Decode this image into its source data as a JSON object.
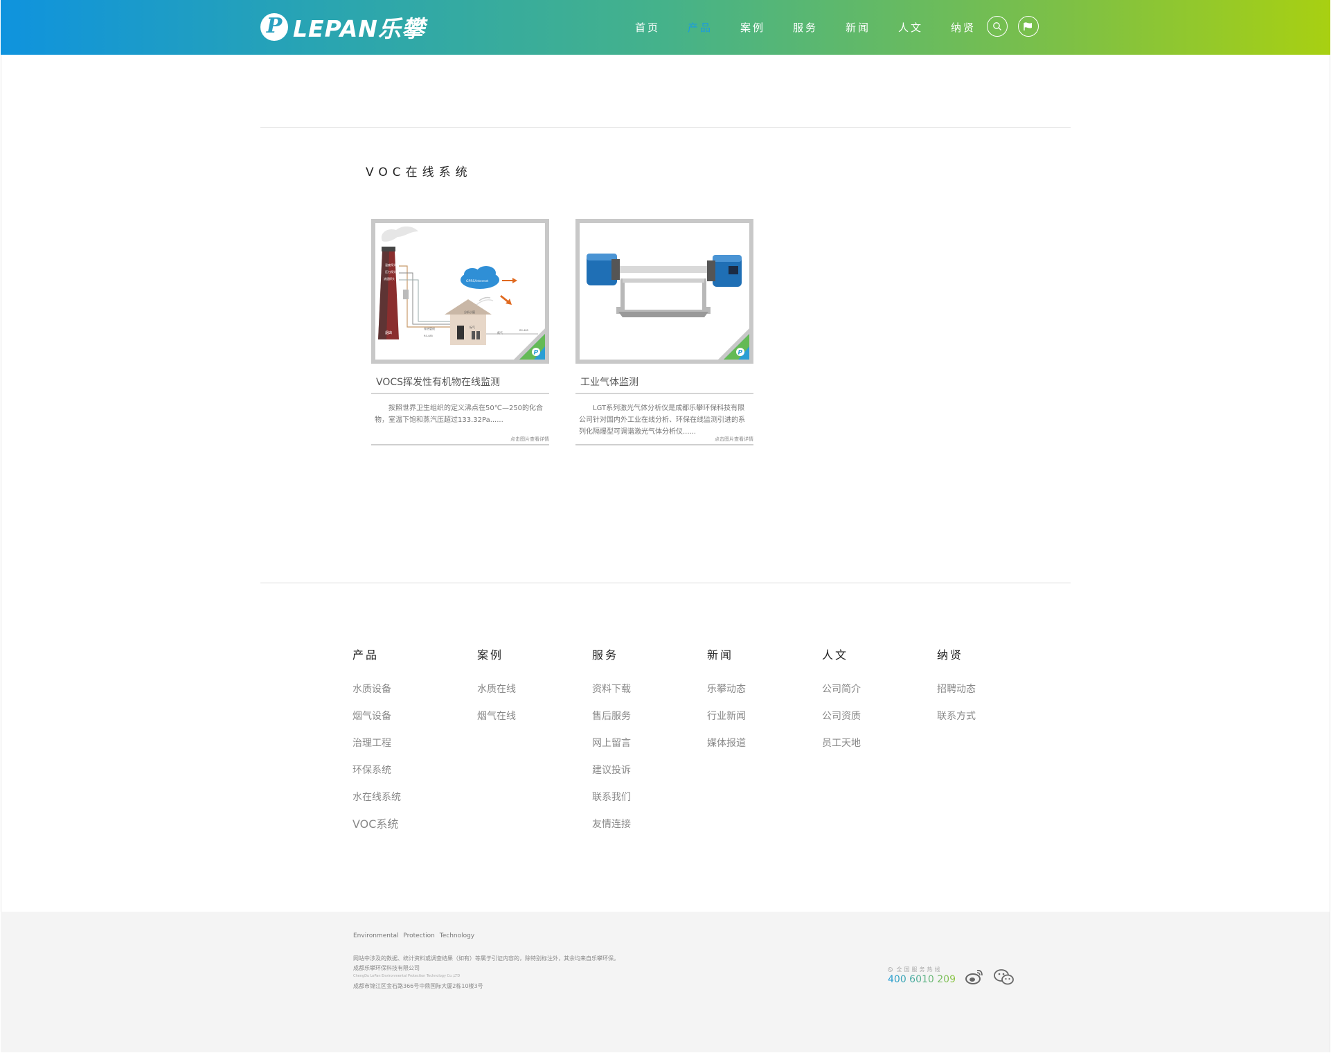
{
  "header": {
    "logo_glyph": "P",
    "logo_text": "LEPAN乐攀",
    "nav": [
      "首页",
      "产品",
      "案例",
      "服务",
      "新闻",
      "人文",
      "纳贤"
    ],
    "active_index": 1,
    "gradient": [
      "#0f93de",
      "#a8d012"
    ]
  },
  "category": {
    "title": "VOC在线系统"
  },
  "products": [
    {
      "title": "VOCS挥发性有机物在线监测",
      "desc": "按照世界卫生组织的定义沸点在50℃—250的化合物，室温下饱和蒸汽压超过133.32Pa......",
      "more": "点击图片查看详情",
      "diagram": {
        "cloud": "GPRS/Internet",
        "house": "分析小屋",
        "stack_labels": [
          "温度探头",
          "压力探头",
          "流速探头"
        ],
        "bottom": [
          "烟囱",
          "伴热管线",
          "RS-485",
          "氮气",
          "标气",
          "RS-485"
        ]
      }
    },
    {
      "title": "工业气体监测",
      "desc": "LGT系列激光气体分析仪是成都乐攀环保科技有限公司针对国内外工业在线分析、环保在线监测引进的系列化隔爆型可调谐激光气体分析仪......",
      "more": "点击图片查看详情"
    }
  ],
  "footer": {
    "columns": [
      {
        "title": "产品",
        "items": [
          "水质设备",
          "烟气设备",
          "治理工程",
          "环保系统",
          "水在线系统",
          "VOC系统"
        ]
      },
      {
        "title": "案例",
        "items": [
          "水质在线",
          "烟气在线"
        ]
      },
      {
        "title": "服务",
        "items": [
          "资料下载",
          "售后服务",
          "网上留言",
          "建议投诉",
          "联系我们",
          "友情连接"
        ]
      },
      {
        "title": "新闻",
        "items": [
          "乐攀动态",
          "行业新闻",
          "媒体报道"
        ]
      },
      {
        "title": "人文",
        "items": [
          "公司简介",
          "公司资质",
          "员工天地"
        ]
      },
      {
        "title": "纳贤",
        "items": [
          "招聘动态",
          "联系方式"
        ]
      }
    ]
  },
  "band": {
    "tagline": "Environmental Protection Technology",
    "notice": "网站中涉及的数据、统计资料或调查结果（如有）等属于引证内容的，除特别标注外，其余均来自乐攀环保。",
    "company": "成都乐攀环保科技有限公司",
    "company_en": "ChengDu LePan Environmental Protection Technology Co.,LTD",
    "address": "成都市锦江区金石路366号中鼎国际大厦2栋10楼3号",
    "hotline_label": "全国服务热线",
    "hotline": "400 6010 209"
  }
}
